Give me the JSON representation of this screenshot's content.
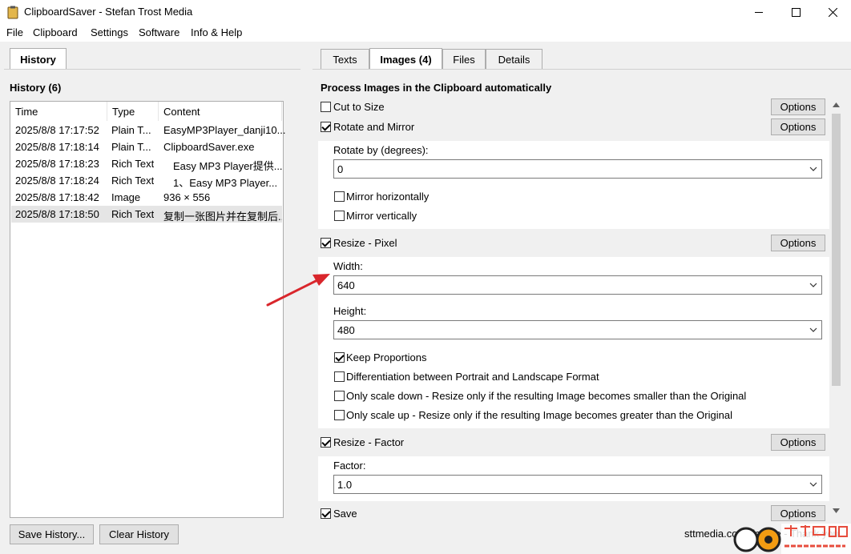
{
  "window": {
    "title": "ClipboardSaver - Stefan Trost Media"
  },
  "menu": {
    "items": [
      "File",
      "Clipboard",
      "Settings",
      "Software",
      "Info & Help"
    ]
  },
  "left_tab": {
    "label": "History"
  },
  "right_tabs": [
    "Texts",
    "Images (4)",
    "Files",
    "Details"
  ],
  "history": {
    "title": "History (6)",
    "columns": [
      "Time",
      "Type",
      "Content"
    ],
    "rows": [
      {
        "time": "2025/8/8 17:17:52",
        "type": "Plain T...",
        "content": "EasyMP3Player_danji10..."
      },
      {
        "time": "2025/8/8 17:18:14",
        "type": "Plain T...",
        "content": "ClipboardSaver.exe"
      },
      {
        "time": "2025/8/8 17:18:23",
        "type": "Rich Text",
        "content": "Easy MP3 Player提供..."
      },
      {
        "time": "2025/8/8 17:18:24",
        "type": "Rich Text",
        "content": "1、Easy MP3 Player..."
      },
      {
        "time": "2025/8/8 17:18:42",
        "type": "Image",
        "content": "936 × 556"
      },
      {
        "time": "2025/8/8 17:18:50",
        "type": "Rich Text",
        "content": "复制一张图片并在复制后..."
      }
    ],
    "save_label": "Save History...",
    "clear_label": "Clear History"
  },
  "process": {
    "title": "Process Images in the Clipboard automatically",
    "options_label": "Options",
    "cut_to_size": {
      "label": "Cut to Size",
      "checked": false
    },
    "rotate_mirror": {
      "label": "Rotate and Mirror",
      "checked": true,
      "rotate_label": "Rotate by (degrees):",
      "rotate_value": "0",
      "mirror_h": {
        "label": "Mirror horizontally",
        "checked": false
      },
      "mirror_v": {
        "label": "Mirror vertically",
        "checked": false
      }
    },
    "resize_pixel": {
      "label": "Resize - Pixel",
      "checked": true,
      "width_label": "Width:",
      "width_value": "640",
      "height_label": "Height:",
      "height_value": "480",
      "keep": {
        "label": "Keep Proportions",
        "checked": true
      },
      "diff": {
        "label": "Differentiation between Portrait and Landscape Format",
        "checked": false
      },
      "down": {
        "label": "Only scale down - Resize only if the resulting Image becomes smaller than the Original",
        "checked": false
      },
      "up": {
        "label": "Only scale up - Resize only if the resulting Image becomes greater than the Original",
        "checked": false
      }
    },
    "resize_factor": {
      "label": "Resize - Factor",
      "checked": true,
      "factor_label": "Factor:",
      "factor_value": "1.0"
    },
    "save": {
      "label": "Save",
      "checked": true
    }
  },
  "footer": {
    "text": "sttmedia.com/donate - Thank you"
  },
  "colors": {
    "arrow": "#d9262c",
    "accent": "#0078d7"
  }
}
